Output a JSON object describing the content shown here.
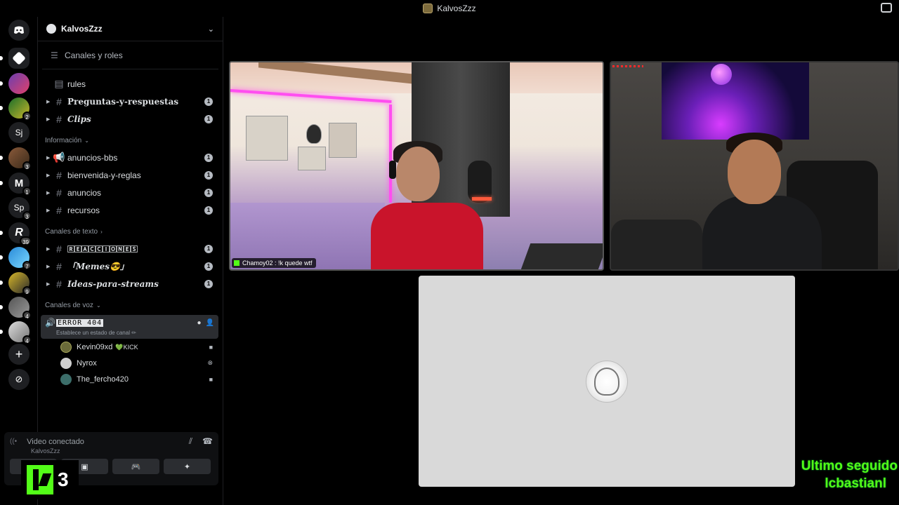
{
  "window": {
    "title": "KalvosZzz"
  },
  "rail": {
    "servers": [
      {
        "label": "",
        "badge": "",
        "icon": "discord-home-icon"
      },
      {
        "label": "",
        "badge": "",
        "icon": "server-red-icon"
      },
      {
        "label": "",
        "badge": "",
        "icon": "server-pixel-icon"
      },
      {
        "label": "",
        "badge": "2",
        "icon": "server-kicklan-icon"
      },
      {
        "label": "Sj",
        "badge": "",
        "icon": ""
      },
      {
        "label": "",
        "badge": "3",
        "icon": "server-avatar-icon"
      },
      {
        "label": "",
        "badge": "1",
        "icon": "server-m-icon"
      },
      {
        "label": "Sp",
        "badge": "3",
        "icon": ""
      },
      {
        "label": "",
        "badge": "39",
        "icon": "server-r-icon"
      },
      {
        "label": "",
        "badge": "7",
        "icon": "server-blue-icon"
      },
      {
        "label": "",
        "badge": "9",
        "icon": "server-yellow-icon"
      },
      {
        "label": "",
        "badge": "4",
        "icon": "server-grey-icon"
      },
      {
        "label": "",
        "badge": "4",
        "icon": "server-cat-icon"
      }
    ],
    "add_label": "+",
    "explore_label": "⊘"
  },
  "sidebar": {
    "server_name": "KalvosZzz",
    "browse_label": "Canales y roles",
    "top_channels": [
      {
        "name": "rules",
        "count": "",
        "style": "plain",
        "icon": "rules-icon"
      },
      {
        "name": "Preguntas-y-respuestas",
        "count": "1",
        "style": "fancy-up",
        "icon": "hash-icon"
      },
      {
        "name": "Clips",
        "count": "1",
        "style": "fancy",
        "icon": "hash-icon"
      }
    ],
    "categories": [
      {
        "name": "Información",
        "channels": [
          {
            "name": "anuncios-bbs",
            "count": "1",
            "style": "plain",
            "icon": "announcement-icon"
          },
          {
            "name": "bienvenida-y-reglas",
            "count": "1",
            "style": "plain",
            "icon": "hash-icon"
          },
          {
            "name": "anuncios",
            "count": "1",
            "style": "plain",
            "icon": "hash-icon"
          },
          {
            "name": "recursos",
            "count": "1",
            "style": "plain",
            "icon": "hash-icon"
          }
        ]
      },
      {
        "name": "Canales de texto",
        "channels": [
          {
            "name": "🅁🄴🄰🄲🄲🄸🄾🄽🄴🅂",
            "count": "1",
            "style": "fancy-up",
            "icon": "hash-icon"
          },
          {
            "name": "「Memes😎」",
            "count": "1",
            "style": "fancy",
            "icon": "hash-icon"
          },
          {
            "name": "Ideas-para-streams",
            "count": "1",
            "style": "fancy",
            "icon": "hash-icon"
          }
        ]
      }
    ],
    "voice_category": "Canales de voz",
    "voice_channel": {
      "name": "ERROR 404",
      "status": "Establece un estado de canal ✏"
    },
    "voice_users": [
      {
        "name": "Kevin09xd",
        "tag": "KICK",
        "color": "#6b6b3a"
      },
      {
        "name": "Nyrox",
        "tag": "",
        "color": "#cfcfcf"
      },
      {
        "name": "The_fercho420",
        "tag": "",
        "color": "#3c6e6a"
      }
    ]
  },
  "voice_panel": {
    "status": "Video conectado",
    "sub": "KalvosZzz"
  },
  "kick_overlay": {
    "count": "3"
  },
  "tiles": [
    {
      "name": "Chamoy02 : !k quede wtf"
    }
  ],
  "follower": {
    "label": "Ultimo seguido",
    "user": "lcbastianl"
  }
}
